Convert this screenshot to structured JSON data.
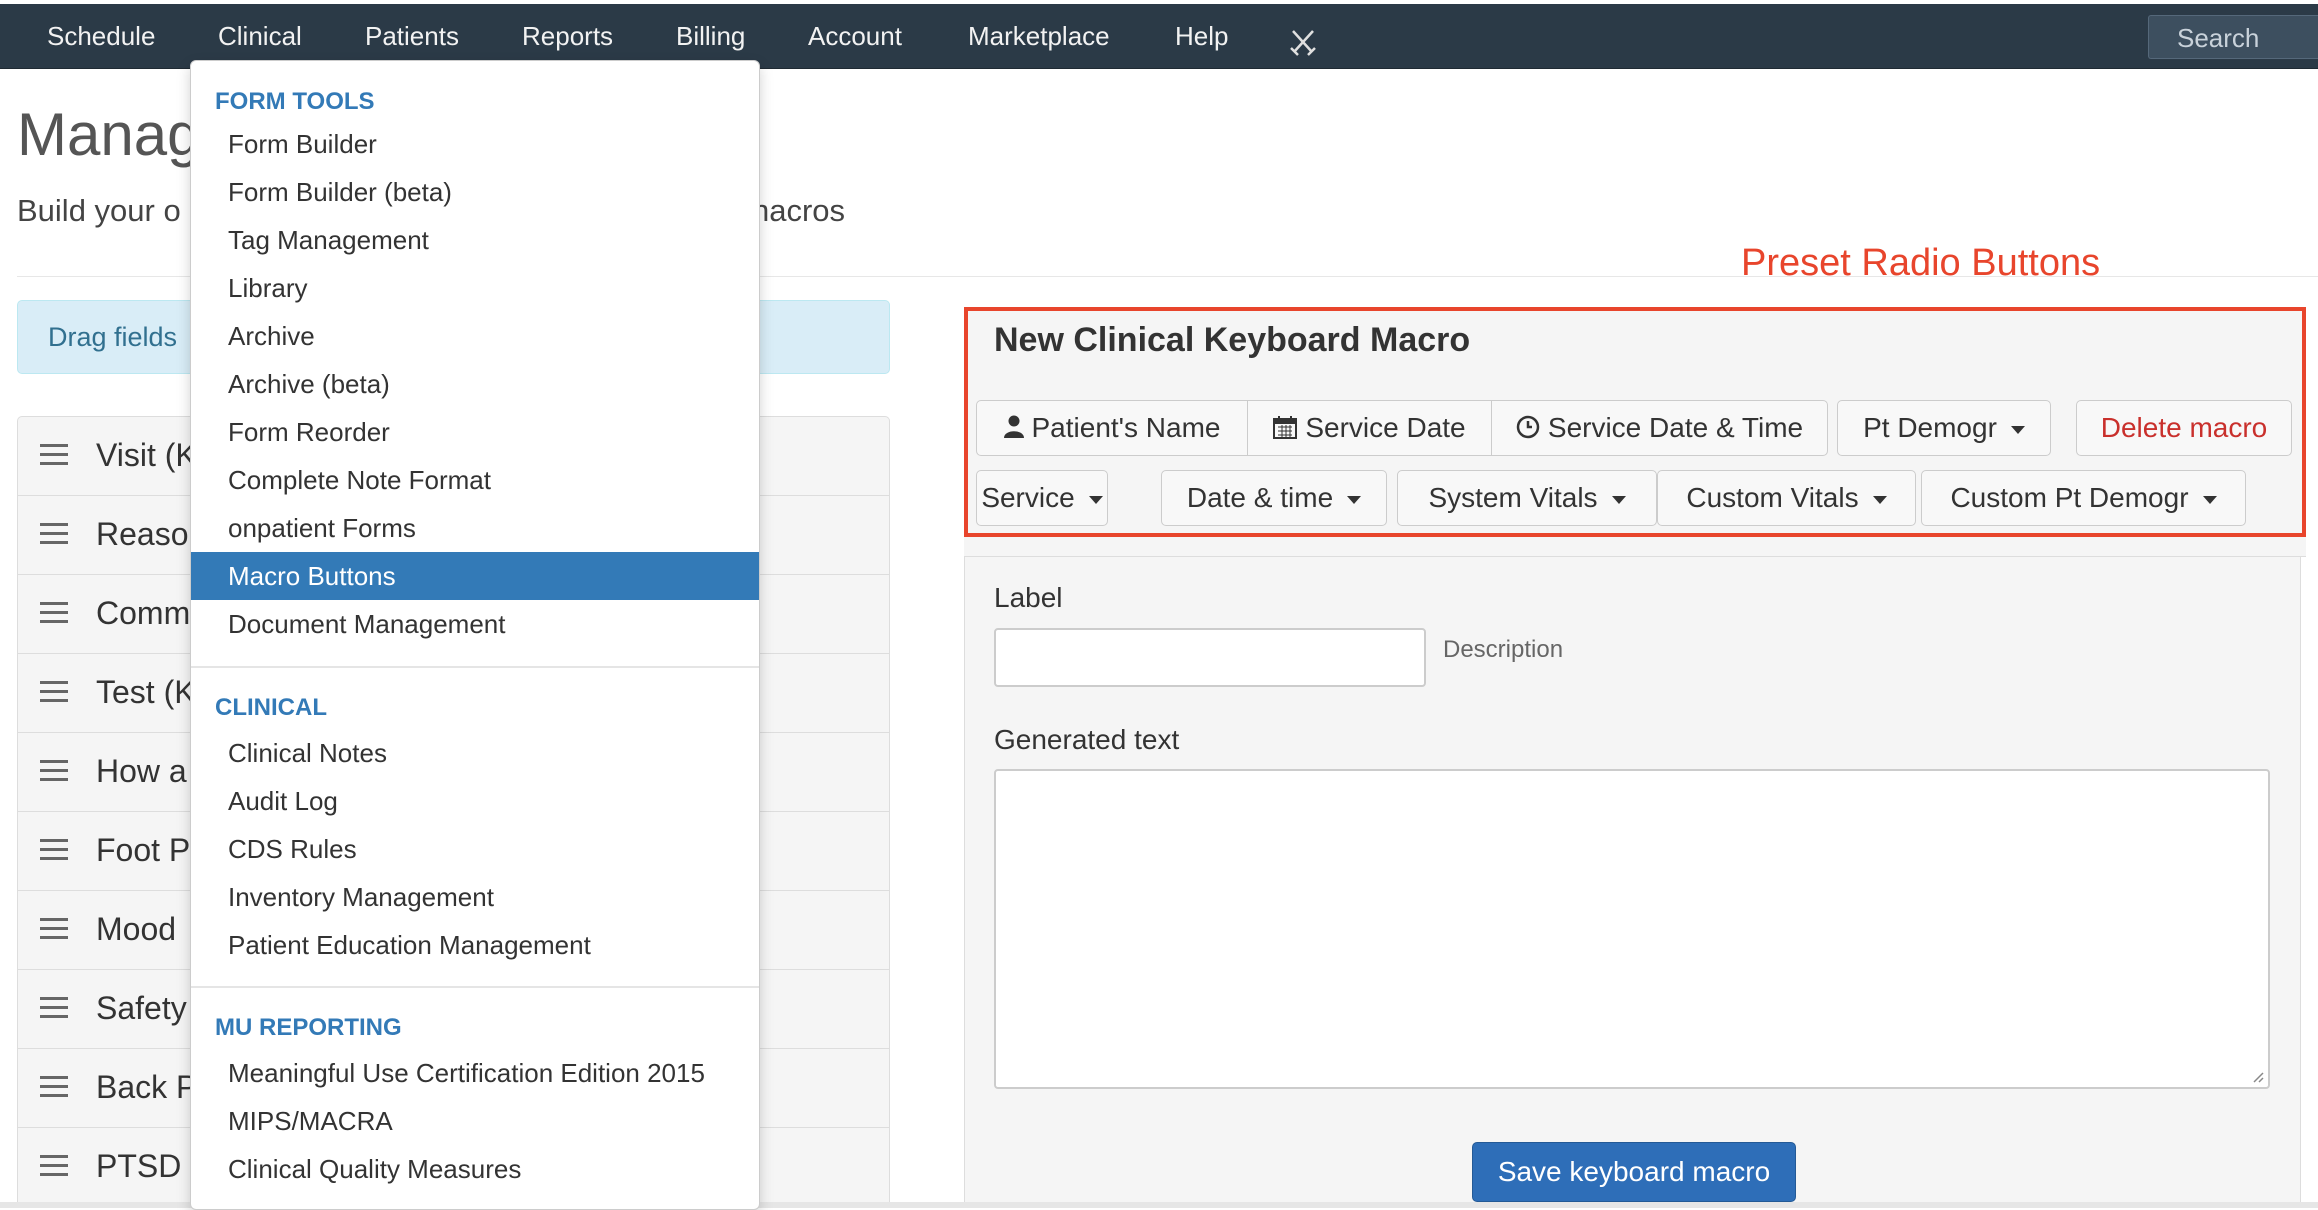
{
  "nav": {
    "items": [
      "Schedule",
      "Clinical",
      "Patients",
      "Reports",
      "Billing",
      "Account",
      "Marketplace",
      "Help"
    ],
    "tools_icon": "crossed-swords-icon",
    "search_label": "Search"
  },
  "page": {
    "title": "Manage",
    "subtitle_start": "Build your o",
    "subtitle_end": "nacros",
    "info_text": "Drag fields"
  },
  "fields": [
    {
      "label": "Visit (K"
    },
    {
      "label": "Reason"
    },
    {
      "label": "Comm"
    },
    {
      "label": "Test (K"
    },
    {
      "label": "How a"
    },
    {
      "label": "Foot P"
    },
    {
      "label": "Mood"
    },
    {
      "label": "Safety"
    },
    {
      "label": "Back P"
    },
    {
      "label": "PTSD"
    }
  ],
  "dropdown": {
    "sections": [
      {
        "header": "FORM TOOLS",
        "items": [
          "Form Builder",
          "Form Builder (beta)",
          "Tag Management",
          "Library",
          "Archive",
          "Archive (beta)",
          "Form Reorder",
          "Complete Note Format",
          "onpatient Forms",
          "Macro Buttons",
          "Document Management"
        ]
      },
      {
        "header": "CLINICAL",
        "items": [
          "Clinical Notes",
          "Audit Log",
          "CDS Rules",
          "Inventory Management",
          "Patient Education Management"
        ]
      },
      {
        "header": "MU REPORTING",
        "items": [
          "Meaningful Use Certification Edition 2015",
          "MIPS/MACRA",
          "Clinical Quality Measures"
        ]
      }
    ],
    "active_item": "Macro Buttons"
  },
  "annotation": "Preset Radio Buttons",
  "macro_panel": {
    "title": "New Clinical Keyboard Macro",
    "row1": [
      {
        "label": "Patient's Name",
        "icon": "user-icon"
      },
      {
        "label": "Service Date",
        "icon": "calendar-icon"
      },
      {
        "label": "Service Date & Time",
        "icon": "clock-icon"
      }
    ],
    "pt_demogr": "Pt Demogr",
    "delete_label": "Delete macro",
    "row2": [
      "Service",
      "Date & time",
      "System Vitals",
      "Custom Vitals",
      "Custom Pt Demogr"
    ],
    "label_field": "Label",
    "label_value": "",
    "description": "Description",
    "generated_text_label": "Generated text",
    "generated_text_value": "",
    "save_label": "Save keyboard macro"
  },
  "colors": {
    "nav_bg": "#2b3a47",
    "accent": "#337ab7",
    "save_button": "#2e6eb8",
    "annotation": "#e8452c",
    "danger": "#c9302c"
  }
}
